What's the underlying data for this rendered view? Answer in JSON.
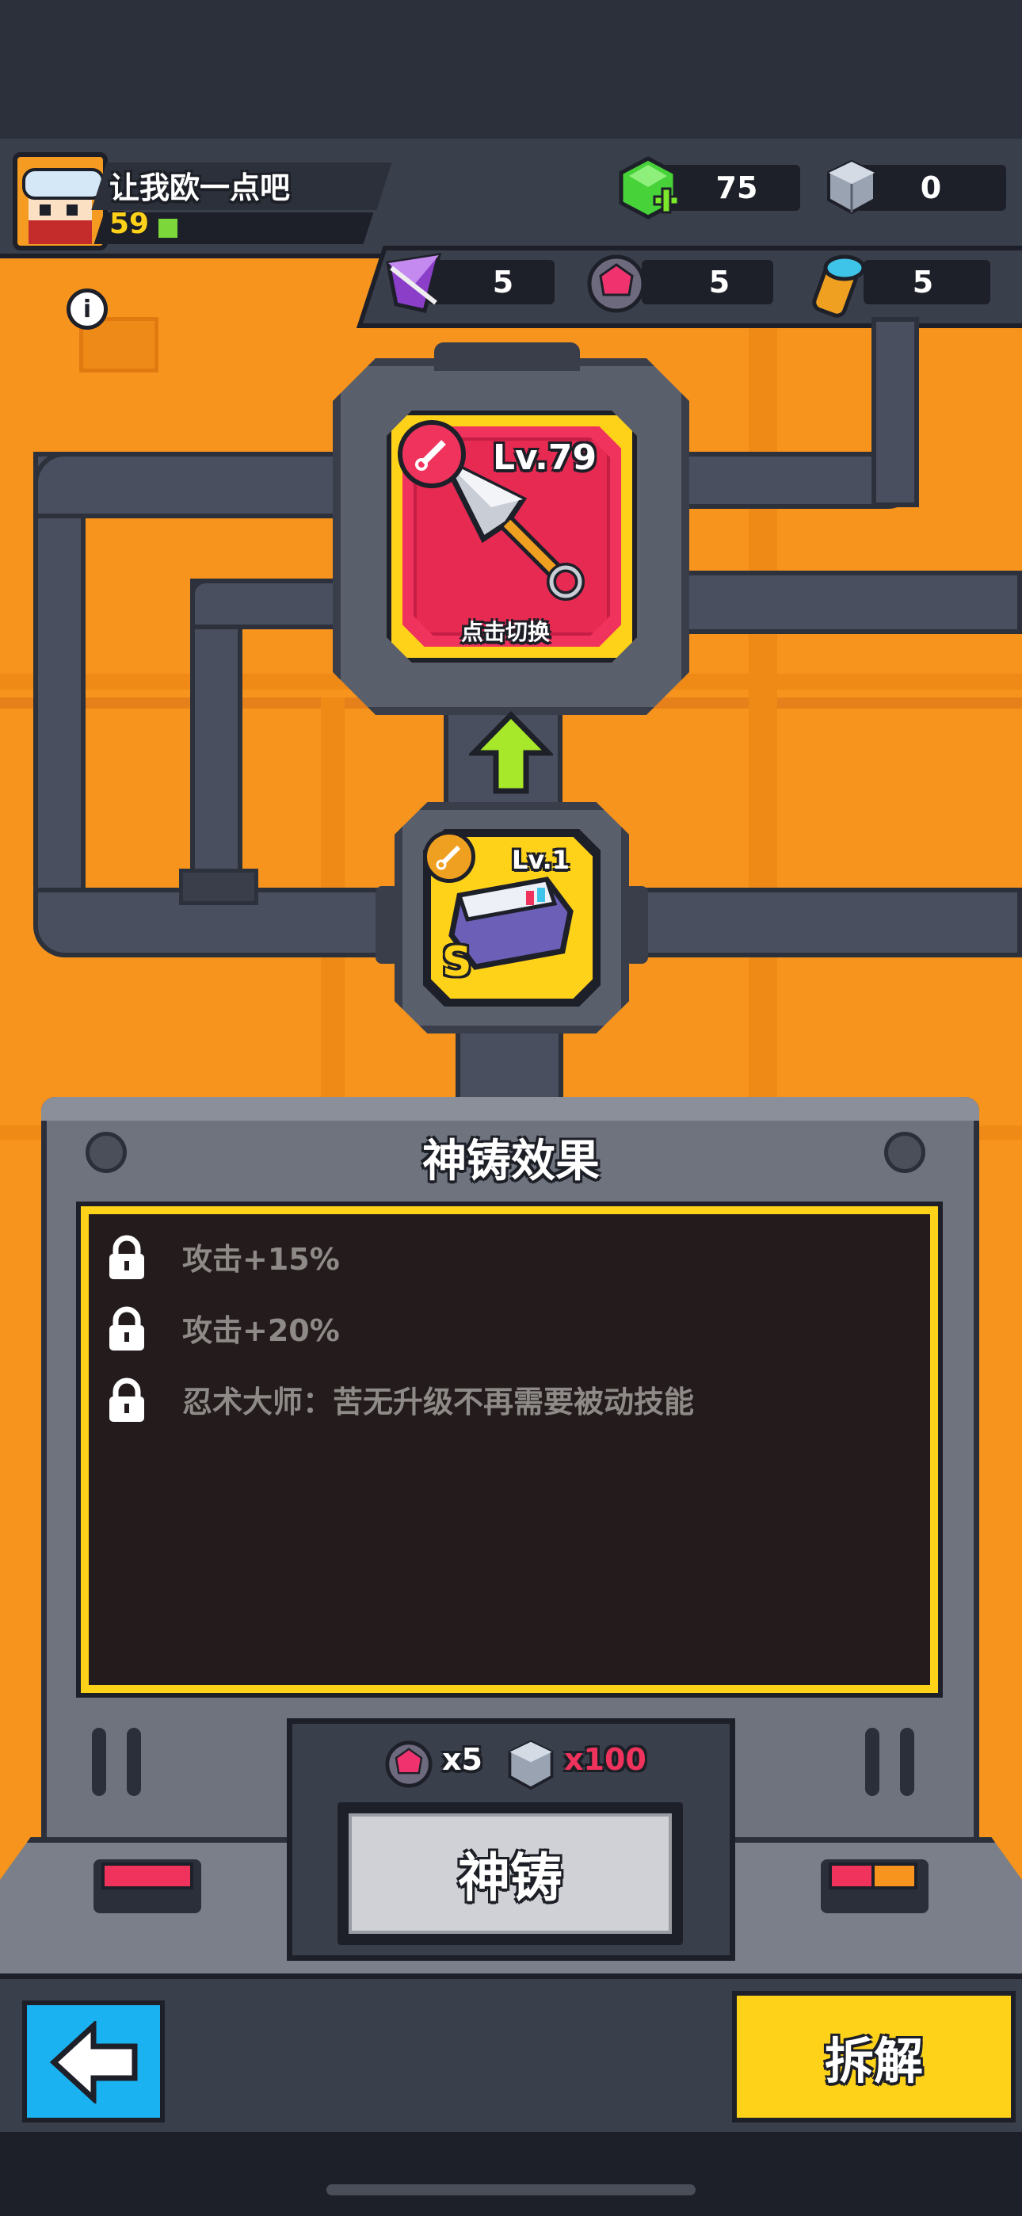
{
  "player": {
    "name": "让我欧一点吧",
    "level": "59",
    "xp_fill": 0.05
  },
  "currency": {
    "gems": "75",
    "cubes": "0"
  },
  "materials": {
    "crystal": "5",
    "orb": "5",
    "scroll": "5"
  },
  "upper_item": {
    "level": "Lv.79",
    "hint": "点击切换"
  },
  "lower_item": {
    "level": "Lv.1",
    "grade": "S"
  },
  "effects": {
    "title": "神铸效果",
    "items": [
      "攻击+15%",
      "攻击+20%",
      "忍术大师：苦无升级不再需要被动技能"
    ]
  },
  "cost": {
    "orb_qty": "x5",
    "cube_qty": "x100"
  },
  "buttons": {
    "forge": "神铸",
    "dismantle": "拆解"
  },
  "colors": {
    "accent_yellow": "#ffd21a",
    "slot_red": "#f0335c",
    "back_blue": "#1ab2f0",
    "bg_orange": "#f7941d"
  }
}
